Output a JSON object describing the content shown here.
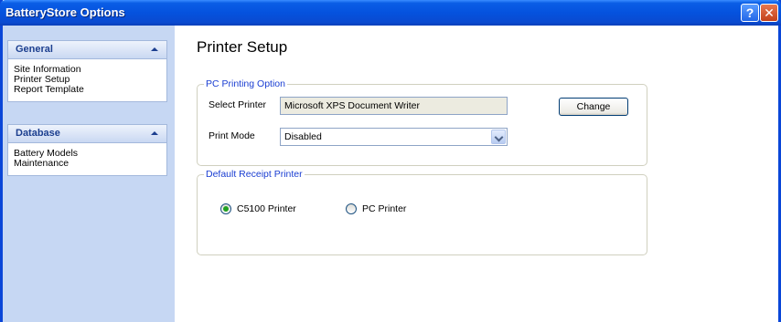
{
  "window": {
    "title": "BatteryStore Options",
    "help_label": "?",
    "close_label": "✕"
  },
  "sidebar": {
    "general": {
      "title": "General",
      "items": [
        "Site Information",
        "Printer Setup",
        "Report Template"
      ]
    },
    "database": {
      "title": "Database",
      "items": [
        "Battery Models",
        "Maintenance"
      ]
    }
  },
  "main": {
    "title": "Printer Setup",
    "pc_printing": {
      "legend": "PC Printing Option",
      "select_printer_label": "Select Printer",
      "select_printer_value": "Microsoft XPS Document Writer",
      "change_button": "Change",
      "print_mode_label": "Print Mode",
      "print_mode_value": "Disabled"
    },
    "receipt": {
      "legend": "Default Receipt Printer",
      "options": [
        {
          "label": "C5100  Printer",
          "selected": true
        },
        {
          "label": "PC Printer",
          "selected": false
        }
      ]
    }
  }
}
